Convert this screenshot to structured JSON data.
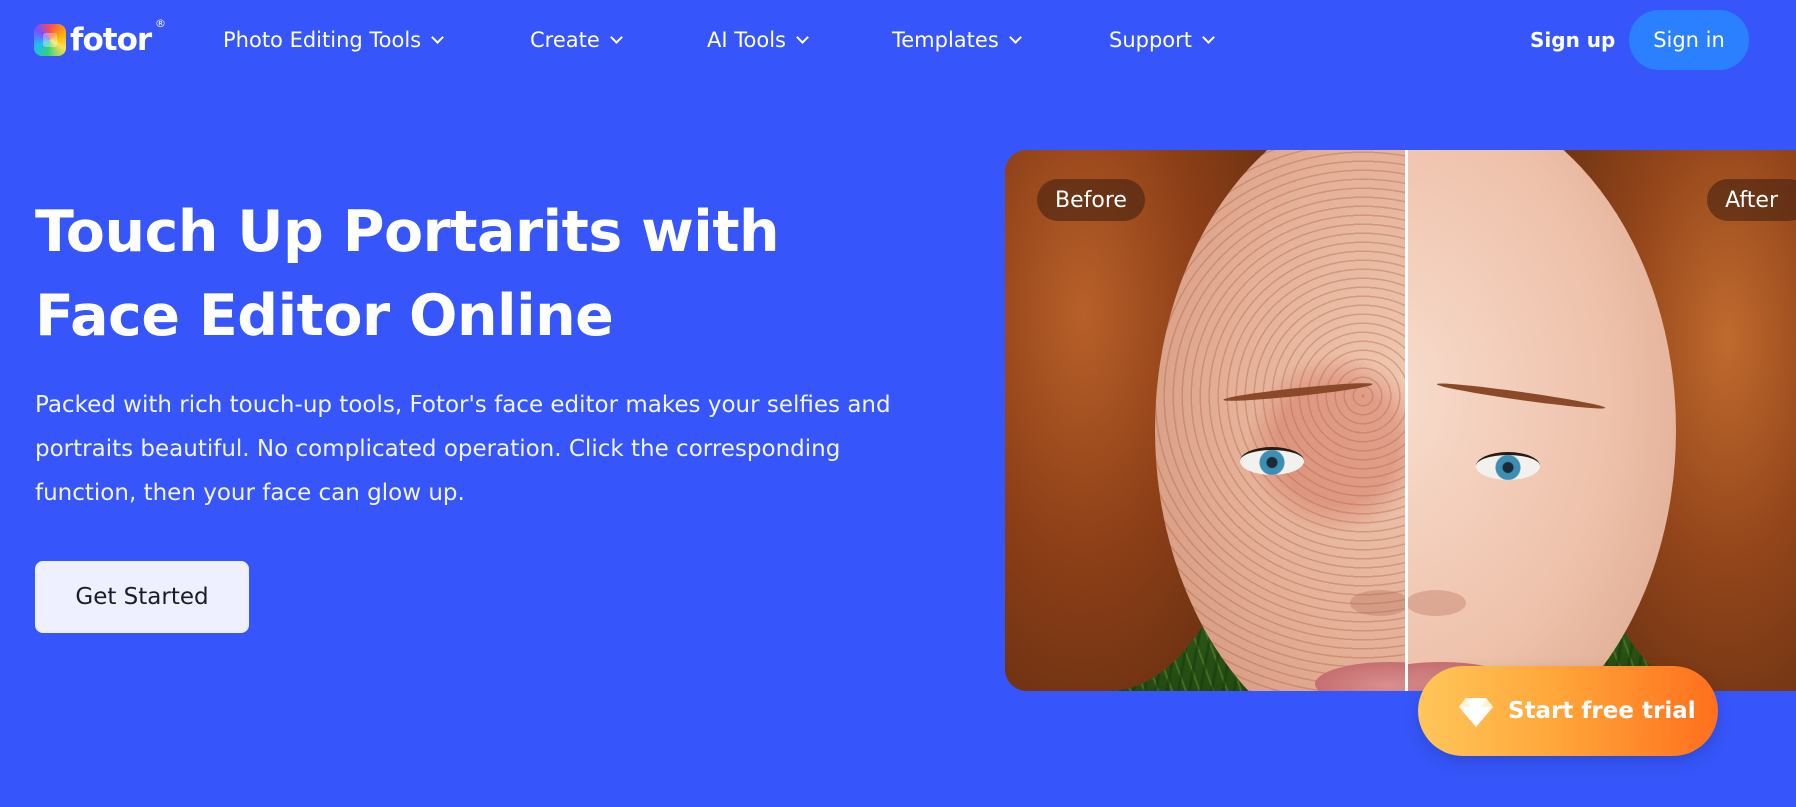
{
  "brand": {
    "name": "fotor",
    "registered_mark": "®",
    "logo_icon": "fotor-logo-icon"
  },
  "nav": {
    "items": [
      {
        "label": "Photo Editing Tools",
        "icon": "chevron-down-icon"
      },
      {
        "label": "Create",
        "icon": "chevron-down-icon"
      },
      {
        "label": "AI Tools",
        "icon": "chevron-down-icon"
      },
      {
        "label": "Templates",
        "icon": "chevron-down-icon"
      },
      {
        "label": "Support",
        "icon": "chevron-down-icon"
      }
    ],
    "sign_up": "Sign up",
    "sign_in": "Sign in"
  },
  "hero": {
    "title_line1": "Touch Up Portarits with",
    "title_line2": "Face Editor Online",
    "description": "Packed with rich touch-up tools, Fotor's face editor makes your selfies and portraits beautiful. No complicated operation. Click the corresponding function, then your face can glow up.",
    "cta": "Get Started"
  },
  "comparison": {
    "before_label": "Before",
    "after_label": "After"
  },
  "trial": {
    "label": "Start free trial",
    "icon": "diamond-icon"
  },
  "colors": {
    "background": "#3656fb",
    "sign_in_button": "#2b80ff",
    "cta_button": "#eef0ff",
    "trial_gradient_start": "#ffc65a",
    "trial_gradient_end": "#ff6f1c"
  }
}
